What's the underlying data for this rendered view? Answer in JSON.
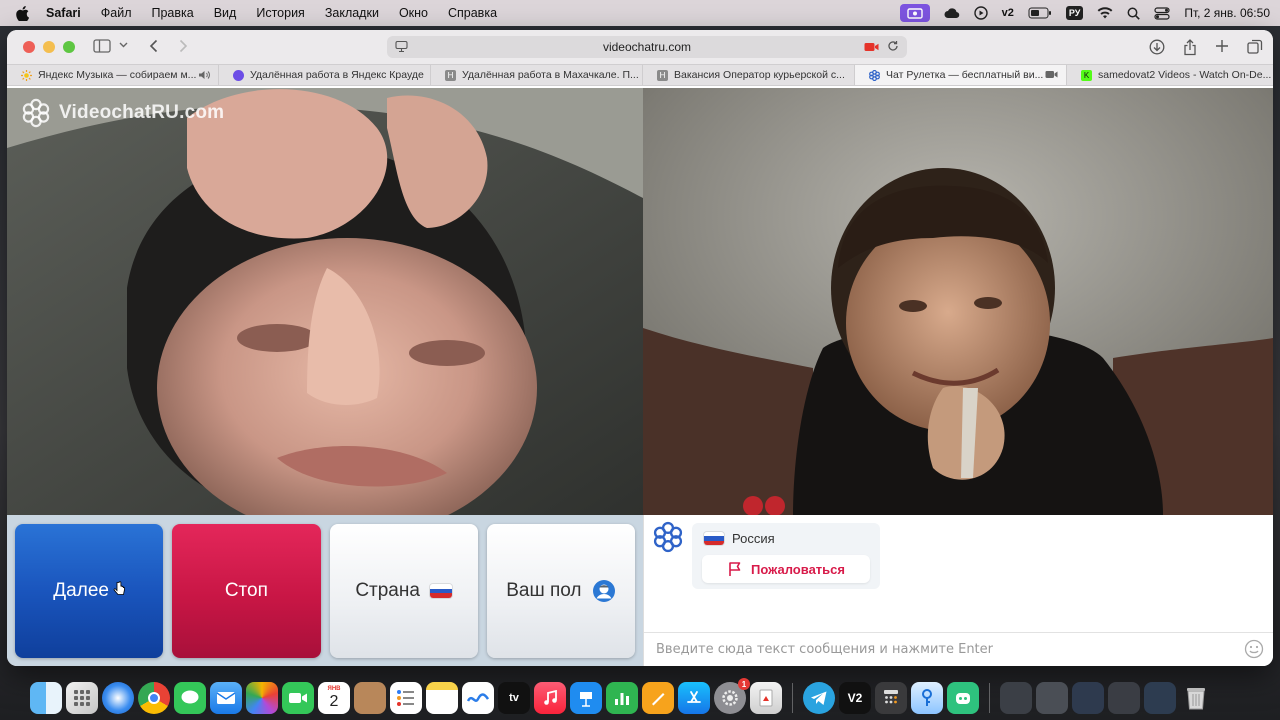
{
  "menubar": {
    "app": "Safari",
    "items": [
      "Файл",
      "Правка",
      "Вид",
      "История",
      "Закладки",
      "Окно",
      "Справка"
    ],
    "lang_badge": "РУ",
    "v2": "v2",
    "clock": "Пт, 2 янв. 06:50"
  },
  "browser": {
    "url": "videochatru.com",
    "tabs": [
      {
        "title": "Яндекс Музыка — собираем м...",
        "favicon": "yandex-music-icon",
        "color": "#f5c518"
      },
      {
        "title": "Удалённая работа в Яндекс Крауде",
        "favicon": "crowd-icon",
        "color": "#6c4de6"
      },
      {
        "title": "Удалённая работа в Махачкале. П...",
        "favicon": "h-icon",
        "color": "#8a8a8a"
      },
      {
        "title": "Вакансия Оператор курьерской с...",
        "favicon": "h-icon",
        "color": "#8a8a8a"
      },
      {
        "title": "Чат Рулетка — бесплатный ви...",
        "favicon": "videochat-icon",
        "color": "#2f63c8",
        "active": true
      },
      {
        "title": "samedovat2 Videos - Watch On-De...",
        "favicon": "kick-icon",
        "color": "#53fc18"
      }
    ]
  },
  "page": {
    "watermark": "VideochatRU.com",
    "buttons": {
      "next": "Далее",
      "stop": "Стоп",
      "country": "Страна",
      "gender": "Ваш пол"
    },
    "partner": {
      "country": "Россия",
      "report": "Пожаловаться"
    },
    "chat_placeholder": "Введите сюда текст сообщения и нажмите Enter"
  },
  "dock": {
    "calendar_day": "2",
    "calendar_month": "ЯНВ",
    "tv_label": "tv",
    "v2_label": "V2",
    "settings_badge": "1"
  },
  "colors": {
    "next": "#1a55bd",
    "stop": "#c81645",
    "report": "#d81b4a",
    "ctrl_bg": "#c9d6e1"
  }
}
